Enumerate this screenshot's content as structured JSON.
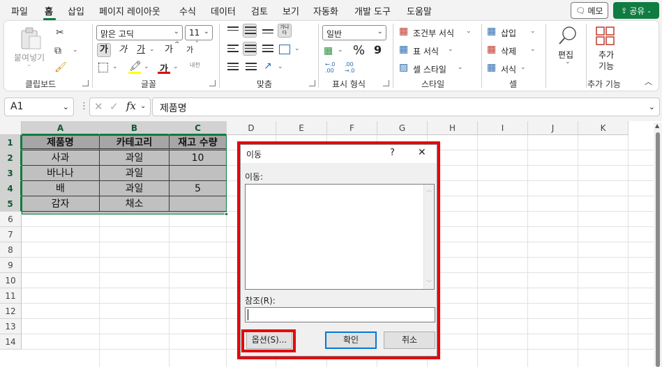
{
  "menu": {
    "items": [
      "파일",
      "홈",
      "삽입",
      "페이지 레이아웃",
      "수식",
      "데이터",
      "검토",
      "보기",
      "자동화",
      "개발 도구",
      "도움말"
    ],
    "memo_label": "메모",
    "share_label": "공유"
  },
  "ribbon": {
    "clipboard": {
      "paste_label": "붙여넣기",
      "group_label": "클립보드"
    },
    "font": {
      "font_name": "맑은 고딕",
      "font_size": "11",
      "group_label": "글꼴",
      "bold": "가",
      "italic": "가",
      "underline": "가",
      "grow": "가",
      "shrink": "가",
      "font_color": "가",
      "phonetic": "내천"
    },
    "alignment": {
      "group_label": "맞춤",
      "wrap": "가나다"
    },
    "number": {
      "format": "일반",
      "percent": "%",
      "comma": "9",
      "group_label": "표시 형식"
    },
    "styles": {
      "conditional": "조건부 서식",
      "table": "표 서식",
      "cell_style": "셀 스타일",
      "group_label": "스타일"
    },
    "cells": {
      "insert": "삽입",
      "delete": "삭제",
      "format": "서식",
      "group_label": "셀"
    },
    "editing": {
      "label": "편집"
    },
    "addins": {
      "label_line1": "추가",
      "label_line2": "기능",
      "group_label": "추가 기능"
    }
  },
  "formula_bar": {
    "name_box": "A1",
    "fx": "fx",
    "content": "제품명"
  },
  "sheet": {
    "columns": [
      "A",
      "B",
      "C",
      "D",
      "E",
      "F",
      "G",
      "H",
      "I",
      "J",
      "K"
    ],
    "rows": [
      "1",
      "2",
      "3",
      "4",
      "5",
      "6",
      "7",
      "8",
      "9",
      "10",
      "11",
      "12",
      "13",
      "14"
    ],
    "table": [
      [
        "제품명",
        "카테고리",
        "재고 수량"
      ],
      [
        "사과",
        "과일",
        "10"
      ],
      [
        "바나나",
        "과일",
        ""
      ],
      [
        "배",
        "과일",
        "5"
      ],
      [
        "감자",
        "채소",
        ""
      ]
    ],
    "selected_fill": "#c0c0c0",
    "header_fill": "#a6a6a6"
  },
  "dialog": {
    "title": "이동",
    "help": "?",
    "close": "✕",
    "goto_label": "이동:",
    "ref_label": "참조(R):",
    "reference_value": "",
    "options_button": "옵션(S)...",
    "ok_button": "확인",
    "cancel_button": "취소",
    "highlight_color": "#e8000b"
  }
}
